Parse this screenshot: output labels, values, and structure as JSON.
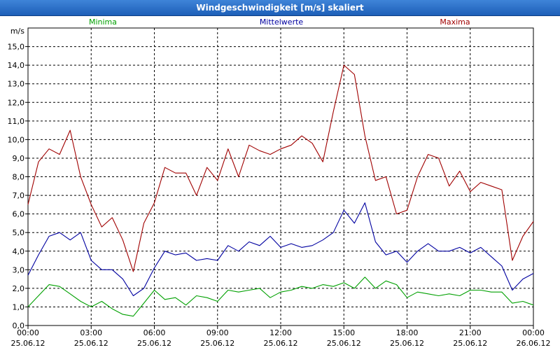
{
  "window": {
    "title": "Windgeschwindigkeit [m/s] skaliert"
  },
  "chart_data": {
    "type": "line",
    "ylabel": "m/s",
    "ylim": [
      0,
      16
    ],
    "yticks": [
      "0,0",
      "1,0",
      "2,0",
      "3,0",
      "4,0",
      "5,0",
      "6,0",
      "7,0",
      "8,0",
      "9,0",
      "10,0",
      "11,0",
      "12,0",
      "13,0",
      "14,0",
      "15,0"
    ],
    "xlim": [
      0,
      24
    ],
    "xticks": [
      {
        "time": "00:00",
        "date": "25.06.12"
      },
      {
        "time": "03:00",
        "date": "25.06.12"
      },
      {
        "time": "06:00",
        "date": "25.06.12"
      },
      {
        "time": "09:00",
        "date": "25.06.12"
      },
      {
        "time": "12:00",
        "date": "25.06.12"
      },
      {
        "time": "15:00",
        "date": "25.06.12"
      },
      {
        "time": "18:00",
        "date": "25.06.12"
      },
      {
        "time": "21:00",
        "date": "25.06.12"
      },
      {
        "time": "00:00",
        "date": "26.06.12"
      }
    ],
    "grid": true,
    "legend_position": "top",
    "x": [
      0,
      0.5,
      1,
      1.5,
      2,
      2.5,
      3,
      3.5,
      4,
      4.5,
      5,
      5.5,
      6,
      6.5,
      7,
      7.5,
      8,
      8.5,
      9,
      9.5,
      10,
      10.5,
      11,
      11.5,
      12,
      12.5,
      13,
      13.5,
      14,
      14.5,
      15,
      15.5,
      16,
      16.5,
      17,
      17.5,
      18,
      18.5,
      19,
      19.5,
      20,
      20.5,
      21,
      21.5,
      22,
      22.5,
      23,
      23.5,
      24
    ],
    "series": [
      {
        "name": "Minima",
        "color": "#00a000",
        "values": [
          1.0,
          1.6,
          2.2,
          2.1,
          1.7,
          1.3,
          1.0,
          1.3,
          0.9,
          0.6,
          0.5,
          1.2,
          1.9,
          1.4,
          1.5,
          1.1,
          1.6,
          1.5,
          1.3,
          1.9,
          1.8,
          1.9,
          2.0,
          1.5,
          1.8,
          1.9,
          2.1,
          2.0,
          2.2,
          2.1,
          2.3,
          2.0,
          2.6,
          2.0,
          2.4,
          2.2,
          1.5,
          1.8,
          1.7,
          1.6,
          1.7,
          1.6,
          1.9,
          1.9,
          1.8,
          1.8,
          1.2,
          1.3,
          1.1
        ]
      },
      {
        "name": "Mittelwerte",
        "color": "#0000a0",
        "values": [
          2.7,
          3.8,
          4.8,
          5.0,
          4.6,
          5.0,
          3.5,
          3.0,
          3.0,
          2.5,
          1.6,
          2.0,
          3.1,
          4.0,
          3.8,
          3.9,
          3.5,
          3.6,
          3.5,
          4.3,
          4.0,
          4.5,
          4.3,
          4.8,
          4.2,
          4.4,
          4.2,
          4.3,
          4.6,
          5.0,
          6.2,
          5.5,
          6.6,
          4.5,
          3.8,
          4.0,
          3.4,
          4.0,
          4.4,
          4.0,
          4.0,
          4.2,
          3.9,
          4.2,
          3.7,
          3.2,
          1.9,
          2.5,
          2.8
        ]
      },
      {
        "name": "Maxima",
        "color": "#a00000",
        "values": [
          6.5,
          8.8,
          9.5,
          9.2,
          10.5,
          8.0,
          6.5,
          5.3,
          5.8,
          4.6,
          2.9,
          5.5,
          6.6,
          8.5,
          8.2,
          8.2,
          7.0,
          8.5,
          7.8,
          9.5,
          8.0,
          9.7,
          9.4,
          9.2,
          9.5,
          9.7,
          10.2,
          9.8,
          8.8,
          11.5,
          14.0,
          13.5,
          10.2,
          7.8,
          8.0,
          6.0,
          6.2,
          8.0,
          9.2,
          9.0,
          7.5,
          8.3,
          7.2,
          7.7,
          7.5,
          7.3,
          3.5,
          4.8,
          5.6
        ]
      }
    ]
  }
}
